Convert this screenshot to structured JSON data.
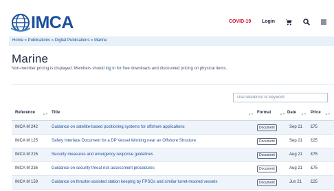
{
  "brand": {
    "logo_text": "IMCA"
  },
  "nav": {
    "covid": "COVID-19",
    "login": "Login"
  },
  "icons": {
    "cart": "cart-icon",
    "search": "search-icon",
    "menu": "hamburger-menu-icon"
  },
  "breadcrumb": "Home » Publications » Digital Publications » Marine",
  "page": {
    "title": "Marine",
    "pricing_before": "Non-member pricing is displayed. Members should ",
    "pricing_link": "log in",
    "pricing_after": " for free downloads and discounted pricing on physical items."
  },
  "search": {
    "placeholder": "Use reference or keyword"
  },
  "table": {
    "headers": {
      "reference": "Reference",
      "title": "Title",
      "format": "Format",
      "date": "Date",
      "price": "Price"
    },
    "rows": [
      {
        "reference": "IMCA M 242",
        "title": "Guidance on satellite-based positioning systems for offshore applications",
        "format": "Document",
        "date": "Sep 21",
        "price": "£75"
      },
      {
        "reference": "IMCA M 125",
        "title": "Safety Interface Document for a DP Vessel Working near an Offshore Structure",
        "format": "Document",
        "date": "Sep 21",
        "price": "£25"
      },
      {
        "reference": "IMCA M 226",
        "title": "Security measures and emergency response guidelines",
        "format": "Document",
        "date": "Aug 21",
        "price": "£75"
      },
      {
        "reference": "IMCA M 236",
        "title": "Guidance on security threat risk assessment procedures",
        "format": "Document",
        "date": "Aug 21",
        "price": "£75"
      },
      {
        "reference": "IMCA M 159",
        "title": "Guidance on thruster-assisted station keeping by FPSOs and similar turret-moored vessels",
        "format": "Document",
        "date": "Jun 21",
        "price": "£25"
      }
    ]
  },
  "colors": {
    "brand_blue": "#1b4f9c",
    "covid_red": "#c8102e",
    "row_alt": "#eef4fa"
  }
}
